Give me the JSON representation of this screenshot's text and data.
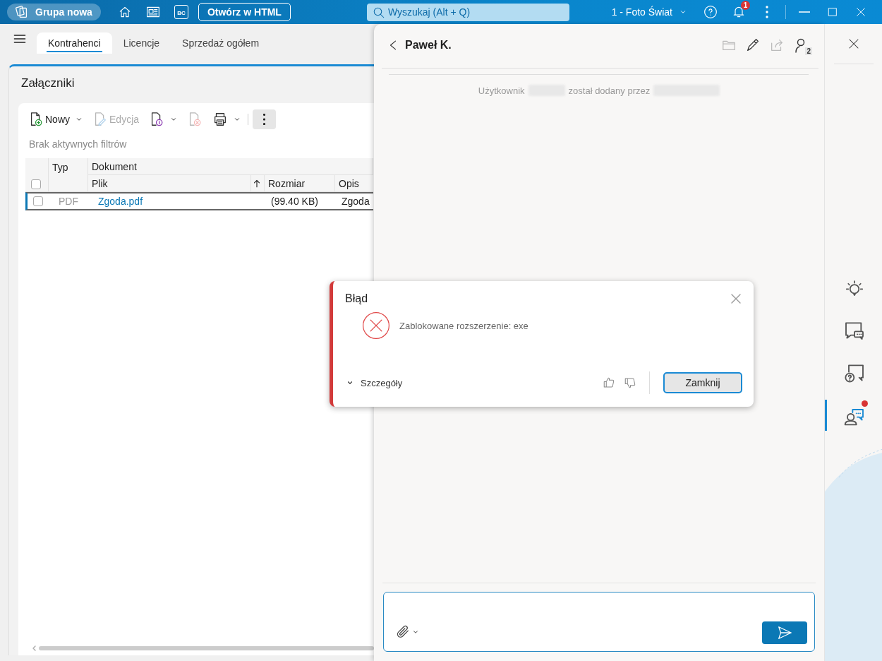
{
  "title_bar": {
    "app_name": "Grupa nowa",
    "bc_label": "BC",
    "open_html_button": "Otwórz w HTML",
    "search": {
      "placeholder": "Wyszukaj (Alt + Q)"
    },
    "company": "1 - Foto Świat",
    "notification_count": "1"
  },
  "tabs": [
    {
      "label": "Kontrahenci",
      "selected": true
    },
    {
      "label": "Licencje",
      "selected": false
    },
    {
      "label": "Sprzedaż ogółem",
      "selected": false
    }
  ],
  "panel": {
    "title": "Załączniki",
    "toolbar": [
      {
        "kind": "new",
        "label": "Nowy",
        "disabled": false,
        "dropdown": true
      },
      {
        "kind": "edit",
        "label": "Edycja",
        "disabled": true,
        "dropdown": false
      },
      {
        "kind": "info",
        "disabled": false,
        "dropdown": true
      },
      {
        "kind": "delete",
        "disabled": true,
        "dropdown": false
      },
      {
        "kind": "print",
        "disabled": false,
        "dropdown": true
      },
      {
        "kind": "more",
        "disabled": false,
        "dropdown": false
      }
    ],
    "filter_status": "Brak aktywnych filtrów",
    "table": {
      "all_selected": false,
      "group_columns": [
        "Typ",
        "Dokument"
      ],
      "columns": [
        "Plik",
        "Rozmiar",
        "Opis"
      ],
      "rows": [
        {
          "checked": false,
          "selected": true,
          "type": "PDF",
          "file": "Zgoda.pdf",
          "size": "(99.40 KB)",
          "description": "Zgoda"
        }
      ]
    }
  },
  "chat": {
    "title": "Paweł K.",
    "participants_count": "2",
    "system_message": {
      "prefix": "Użytkownik",
      "middle": "został dodany przez"
    }
  },
  "dialog": {
    "title": "Błąd",
    "message": "Zablokowane rozszerzenie: exe",
    "details_label": "Szczegóły",
    "expanded": false,
    "close_button": "Zamknij"
  },
  "rail": {
    "items": [
      {
        "kind": "tips",
        "selected": false,
        "unread": false
      },
      {
        "kind": "chat",
        "selected": false,
        "unread": false
      },
      {
        "kind": "help",
        "selected": false,
        "unread": false
      },
      {
        "kind": "contacts",
        "selected": true,
        "unread": true
      }
    ]
  }
}
